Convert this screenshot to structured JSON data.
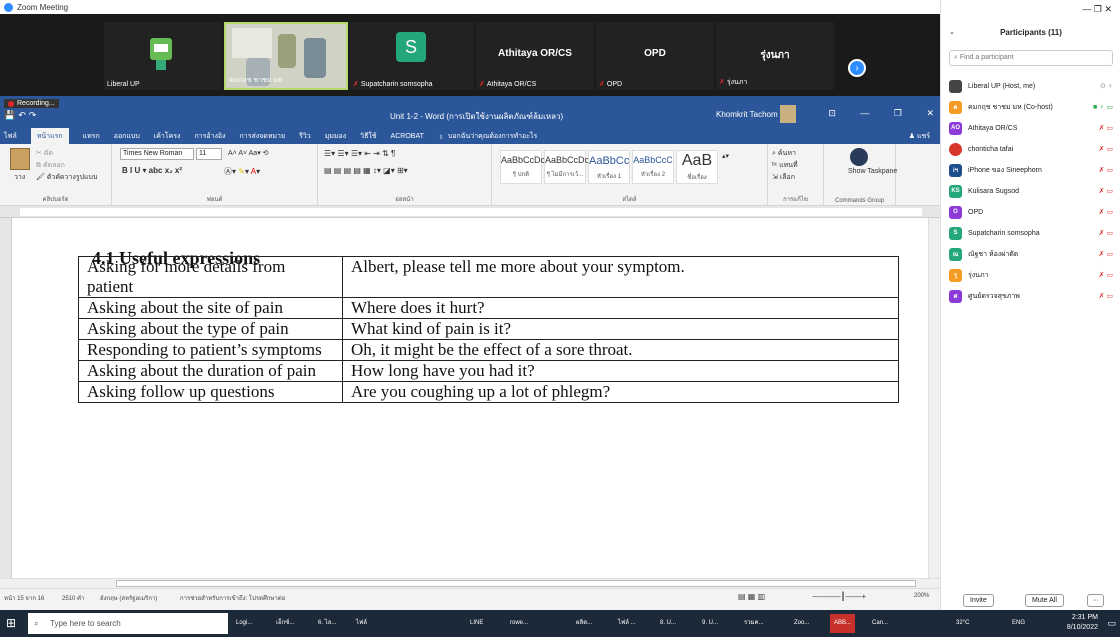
{
  "zoom": {
    "window_title": "Zoom Meeting",
    "recording": "Recording...",
    "tiles": [
      {
        "name": "Liberal UP",
        "center": "",
        "type": "avatar"
      },
      {
        "name": "คมกฤช ชาชม มห",
        "center": "",
        "type": "video"
      },
      {
        "name": "Supatcharin somsopha",
        "center": "S",
        "type": "letter"
      },
      {
        "name": "Athitaya OR/CS",
        "center": "Athitaya OR/CS",
        "type": "name"
      },
      {
        "name": "OPD",
        "center": "OPD",
        "type": "name"
      },
      {
        "name": "รุ่งนภา",
        "center": "รุ่งนภา",
        "type": "name"
      }
    ],
    "next_icon": "chevron-right-icon"
  },
  "word": {
    "doc_title": "Unit 1-2 - Word (การเปิดใช้งานผลิตภัณฑ์ล้มเหลว)",
    "user": "Khomkrit Tachom",
    "tabs": [
      "ไฟล์",
      "หน้าแรก",
      "แทรก",
      "ออกแบบ",
      "เค้าโครง",
      "การอ้างอิง",
      "การส่งจดหมาย",
      "รีวิว",
      "มุมมอง",
      "วิธีใช้",
      "ACROBAT"
    ],
    "tell_me": "บอกฉันว่าคุณต้องการทำอะไร",
    "share": "แชร์",
    "ribbon": {
      "paste_label": "วาง",
      "cut": "ตัด",
      "copy": "คัดลอก",
      "format_painter": "ตัวคัดวางรูปแบบ",
      "clipboard": "คลิปบอร์ด",
      "font_name": "Times New Roman",
      "font_size": "11",
      "font_group": "ฟอนต์",
      "paragraph_group": "ย่อหน้า",
      "styles": [
        {
          "preview": "AaBbCcDc",
          "name": "¶ ปกติ"
        },
        {
          "preview": "AaBbCcDc",
          "name": "¶ ไม่มีการเว้..."
        },
        {
          "preview": "AaBbCc",
          "name": "หัวเรื่อง 1"
        },
        {
          "preview": "AaBbCcC",
          "name": "หัวเรื่อง 2"
        },
        {
          "preview": "AaB",
          "name": "ชื่อเรื่อง"
        }
      ],
      "styles_group": "สไตล์",
      "find": "ค้นหา",
      "replace": "แทนที่",
      "select": "เลือก",
      "editing_group": "การแก้ไข",
      "show_taskpane": "Show Taskpane",
      "commands_group": "Commands Group"
    },
    "heading": "4.1 Useful expressions",
    "table": [
      [
        "Asking for more details from patient",
        "Albert, please tell me more about your symptom."
      ],
      [
        "Asking about the site of pain",
        "Where does it hurt?"
      ],
      [
        "Asking about the type of pain",
        "What kind of pain is it?"
      ],
      [
        "Responding to patient’s symptoms",
        "Oh, it might be the effect of a sore throat."
      ],
      [
        "Asking about the duration of pain",
        "How long have you had it?"
      ],
      [
        "Asking follow up questions",
        "Are you coughing up a lot of phlegm?"
      ]
    ],
    "status": {
      "page": "หน้า 15 จาก 16",
      "words": "2510 คำ",
      "language": "อังกฤษ (สหรัฐอเมริกา)",
      "accessibility": "การช่วยสำหรับการเข้าถึง: โปรดศึกษาต่อ",
      "zoom": "200%"
    }
  },
  "panel": {
    "title": "Participants (11)",
    "search_placeholder": "Find a participant",
    "participants": [
      {
        "name": "Liberal UP (Host, me)",
        "initial": "",
        "color": "#444444"
      },
      {
        "name": "คมกฤช ชาชม มห (Co-host)",
        "initial": "ค",
        "color": "#f59a23"
      },
      {
        "name": "Athitaya OR/CS",
        "initial": "AO",
        "color": "#8c3bd8"
      },
      {
        "name": "chonticha tafai",
        "initial": "",
        "color": "#d8352a"
      },
      {
        "name": "iPhone ของ Sineephorn",
        "initial": "iฯ",
        "color": "#1e4f8c"
      },
      {
        "name": "Kulisara Sugsod",
        "initial": "KS",
        "color": "#24a87b"
      },
      {
        "name": "OPD",
        "initial": "O",
        "color": "#8c3bd8"
      },
      {
        "name": "Supatcharin somsopha",
        "initial": "S",
        "color": "#24a87b"
      },
      {
        "name": "ณัฐชา ห้องผ่าตัด",
        "initial": "ณ",
        "color": "#24a87b"
      },
      {
        "name": "รุ่งนภา",
        "initial": "รุ",
        "color": "#f59a23"
      },
      {
        "name": "ศูนย์ตรวจสุขภาพ",
        "initial": "ศ",
        "color": "#8c3bd8"
      }
    ],
    "invite": "Invite",
    "mute_all": "Mute All"
  },
  "taskbar": {
    "search_placeholder": "Type here to search",
    "items": [
      "Logi...",
      "เอ็กซ์...",
      "6. ไล...",
      "ไฟล์",
      "LINE",
      "rowe...",
      "ผลิต...",
      "ไฟล์ ...",
      "8. U...",
      "9. U...",
      "รวมค...",
      "Zoo...",
      "ABB...",
      "Can..."
    ],
    "weather": "32°C",
    "lang": "ENG",
    "time": "2:31 PM",
    "date": "8/10/2022"
  }
}
